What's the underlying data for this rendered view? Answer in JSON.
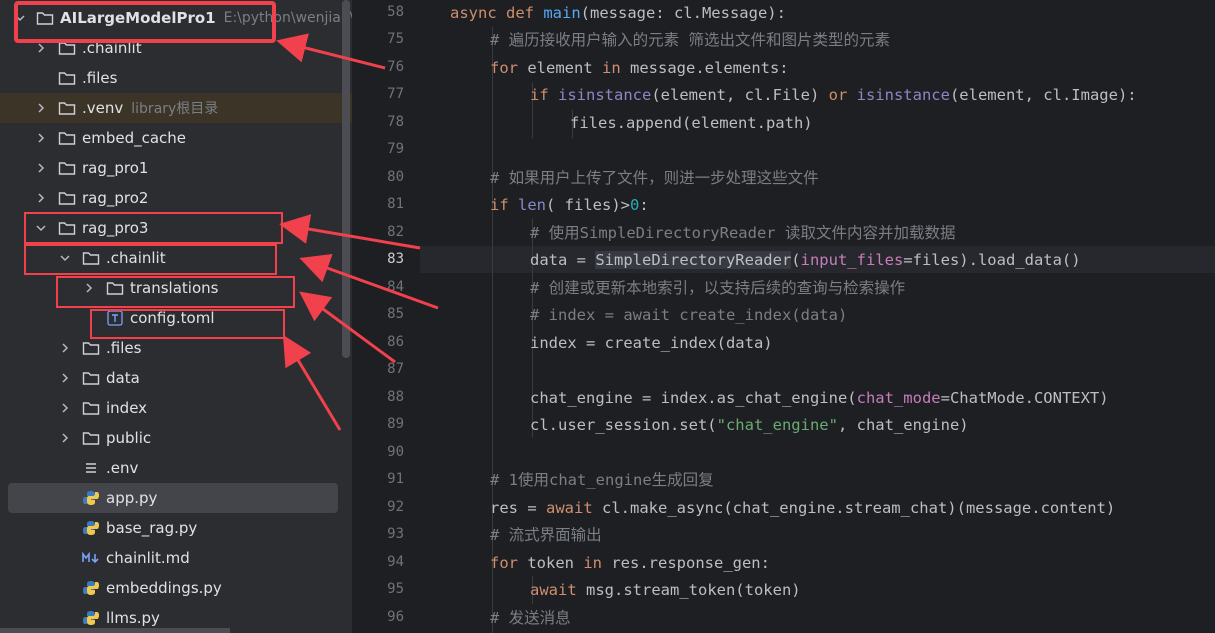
{
  "project_tree": {
    "root": {
      "label": "AILargeModelPro1",
      "path": "E:\\python\\wenjian\\AI"
    },
    "items": [
      {
        "label": ".chainlit",
        "type": "folder",
        "expandable": true
      },
      {
        "label": ".files",
        "type": "folder",
        "expandable": false
      },
      {
        "label": ".venv",
        "type": "folder",
        "expandable": true,
        "note": "library根目录"
      },
      {
        "label": "embed_cache",
        "type": "folder",
        "expandable": true
      },
      {
        "label": "rag_pro1",
        "type": "folder",
        "expandable": true
      },
      {
        "label": "rag_pro2",
        "type": "folder",
        "expandable": true
      },
      {
        "label": "rag_pro3",
        "type": "folder",
        "expandable": true,
        "expanded": true
      },
      {
        "label": ".chainlit",
        "type": "folder",
        "expandable": true,
        "expanded": true
      },
      {
        "label": "translations",
        "type": "folder",
        "expandable": true
      },
      {
        "label": "config.toml",
        "type": "toml-file"
      },
      {
        "label": ".files",
        "type": "folder",
        "expandable": true
      },
      {
        "label": "data",
        "type": "folder",
        "expandable": true
      },
      {
        "label": "index",
        "type": "folder",
        "expandable": true
      },
      {
        "label": "public",
        "type": "folder",
        "expandable": true
      },
      {
        "label": ".env",
        "type": "text-file"
      },
      {
        "label": "app.py",
        "type": "python-file",
        "selected": true
      },
      {
        "label": "base_rag.py",
        "type": "python-file"
      },
      {
        "label": "chainlit.md",
        "type": "markdown-file"
      },
      {
        "label": "embeddings.py",
        "type": "python-file"
      },
      {
        "label": "llms.py",
        "type": "python-file"
      }
    ]
  },
  "editor": {
    "current_line": "83",
    "line_numbers": [
      "58",
      "75",
      "76",
      "77",
      "78",
      "79",
      "80",
      "81",
      "82",
      "83",
      "84",
      "85",
      "86",
      "87",
      "88",
      "89",
      "90",
      "91",
      "92",
      "93",
      "94",
      "95",
      "96"
    ],
    "code": {
      "l58": {
        "kw1": "async def ",
        "fn": "main",
        "rest": "(message: cl.Message):"
      },
      "l75": "# 遍历接收用户输入的元素 筛选出文件和图片类型的元素",
      "l76": {
        "kw1": "for",
        "a": " element ",
        "kw2": "in",
        "b": " message.elements:"
      },
      "l77": {
        "kw1": "if ",
        "bi1": "isinstance",
        "a": "(element, cl.File) ",
        "kw2": "or ",
        "bi2": "isinstance",
        "b": "(element, cl.Image):"
      },
      "l78": "files.append(element.path)",
      "l80": "# 如果用户上传了文件，则进一步处理这些文件",
      "l81": {
        "kw1": "if ",
        "bi1": "len",
        "a": "( files)>",
        "num": "0",
        "b": ":"
      },
      "l82": "# 使用SimpleDirectoryReader 读取文件内容并加载数据",
      "l83": {
        "a": "data = ",
        "hl": "SimpleDirectoryReader",
        "b": "(",
        "param": "input_files",
        "c": "=files).load_data()"
      },
      "l84": "# 创建或更新本地索引，以支持后续的查询与检索操作",
      "l85": "# index = await create_index(data)",
      "l86": "index = create_index(data)",
      "l88": {
        "a": "chat_engine = index.as_chat_engine(",
        "param": "chat_mode",
        "b": "=ChatMode.CONTEXT)"
      },
      "l89": {
        "a": "cl.user_session.set(",
        "str": "\"chat_engine\"",
        "b": ", chat_engine)"
      },
      "l91": "# 1使用chat_engine生成回复",
      "l92": {
        "a": "res = ",
        "kw1": "await",
        "b": " cl.make_async(chat_engine.stream_chat)(message.content)"
      },
      "l93": "# 流式界面输出",
      "l94": {
        "kw1": "for",
        "a": " token ",
        "kw2": "in",
        "b": " res.response_gen:"
      },
      "l95": {
        "kw1": "await",
        "a": " msg.stream_token(token)"
      },
      "l96": "# 发送消息"
    }
  },
  "colors": {
    "annotation_red": "#f0414d",
    "sidebar_bg": "#2b2d30",
    "editor_bg": "#1e1f22",
    "keyword": "#cf8e6d",
    "function": "#56a8f5",
    "comment": "#7a7e85"
  }
}
